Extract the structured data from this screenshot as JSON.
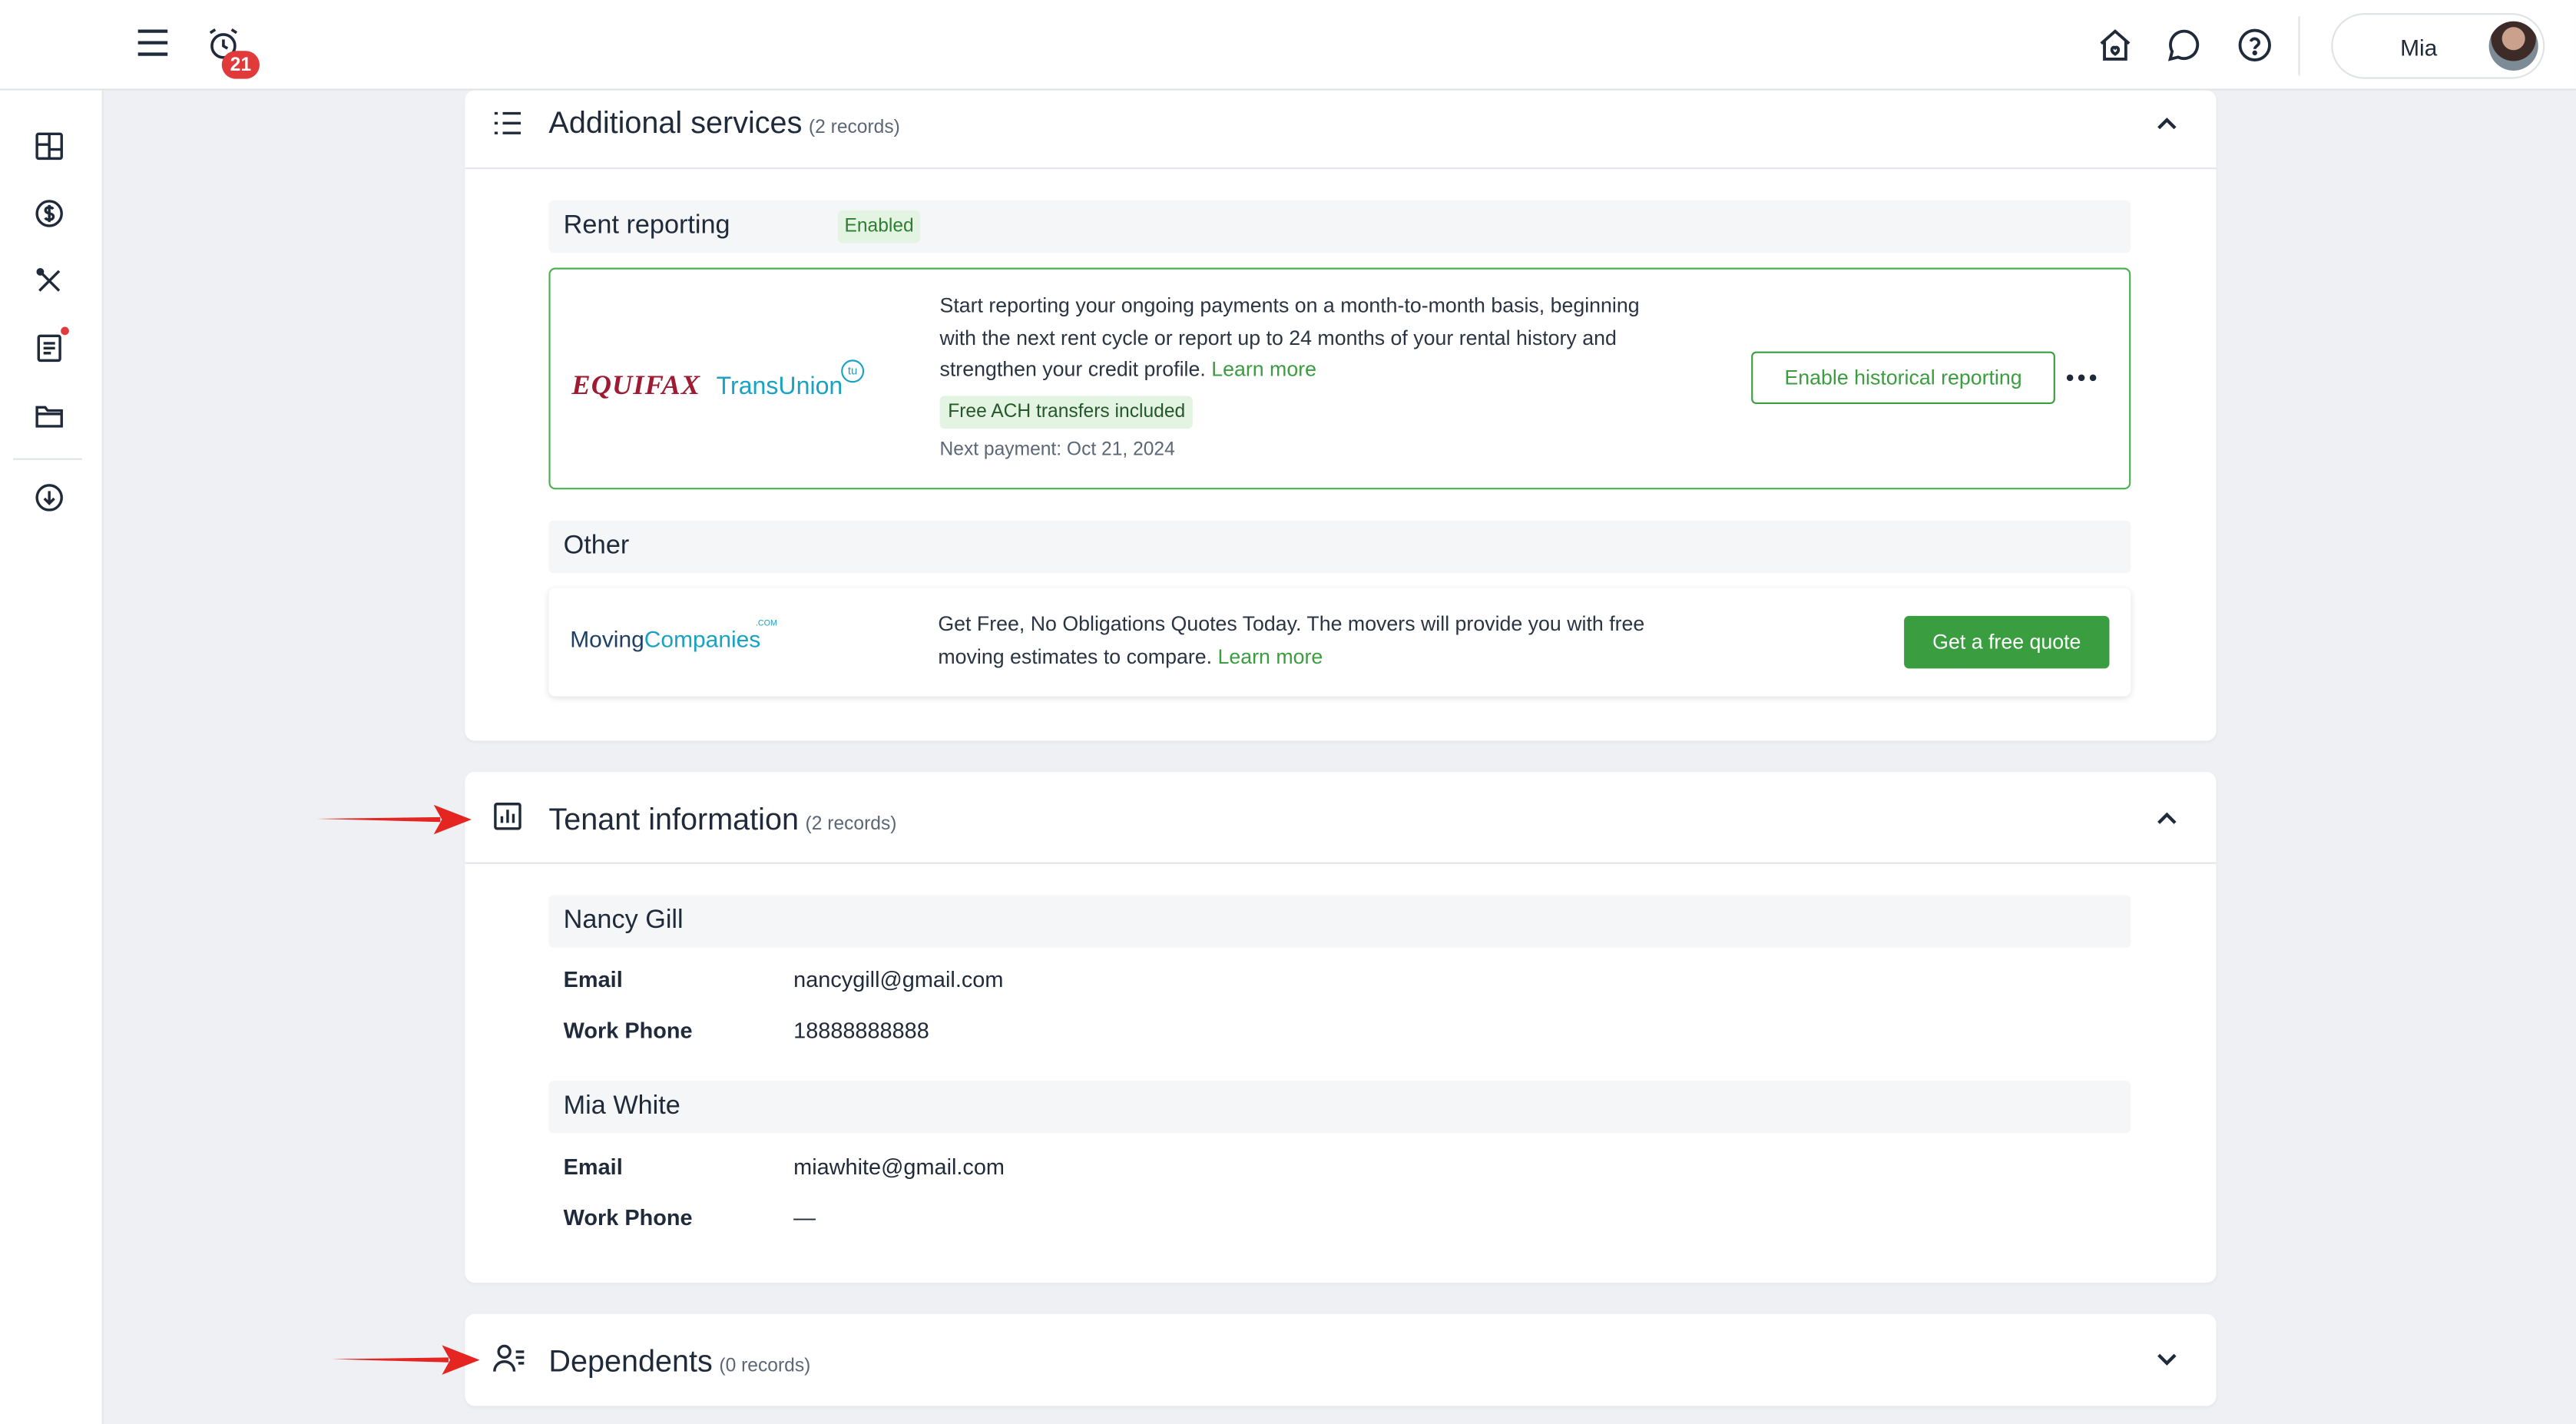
{
  "colors": {
    "accent_green": "#3a9d3f",
    "badge_red": "#e03a3a",
    "annotation_red": "#e52521",
    "equifax_red": "#9e1b32",
    "transunion_cyan": "#1aa2c4"
  },
  "topbar": {
    "menu_icon": "hamburger-icon",
    "alarm_icon": "alarm-clock-icon",
    "notification_count": "21",
    "home_icon": "home-icon",
    "chat_icon": "chat-bubble-icon",
    "help_icon": "help-circle-icon",
    "user_name": "Mia"
  },
  "sidebar": {
    "items": [
      {
        "icon": "dashboard-grid-icon"
      },
      {
        "icon": "dollar-circle-icon"
      },
      {
        "icon": "tools-icon"
      },
      {
        "icon": "document-list-icon",
        "has_notification_dot": true
      },
      {
        "icon": "folder-icon"
      },
      {
        "icon": "cloud-download-icon"
      }
    ]
  },
  "additional_services": {
    "title": "Additional services",
    "count": "(2 records)",
    "rent_reporting": {
      "label": "Rent reporting",
      "status": "Enabled",
      "logo_equifax": "EQUIFAX",
      "logo_transunion": "TransUnion",
      "logo_transunion_badge": "tu",
      "description_line1": "Start reporting your ongoing payments on a month-to-month basis, beginning",
      "description_line2": "with the next rent cycle or report up to 24 months of your rental history and",
      "description_line3": "strengthen your credit profile.",
      "learn_more": "Learn more",
      "free_tag": "Free ACH transfers included",
      "next_payment": "Next payment: Oct 21, 2024",
      "button_label": "Enable historical reporting"
    },
    "other": {
      "label": "Other",
      "logo_part1": "Moving",
      "logo_part2": "Companies",
      "logo_dotcom": ".COM",
      "description_line1": "Get Free, No Obligations Quotes Today. The movers will provide you with free",
      "description_line2": "moving estimates to compare.",
      "learn_more": "Learn more",
      "button_label": "Get a free quote"
    }
  },
  "tenant_information": {
    "title": "Tenant information",
    "count": "(2 records)",
    "tenants": [
      {
        "name": "Nancy Gill",
        "email_label": "Email",
        "email": "nancygill@gmail.com",
        "phone_label": "Work Phone",
        "phone": "18888888888"
      },
      {
        "name": "Mia White",
        "email_label": "Email",
        "email": "miawhite@gmail.com",
        "phone_label": "Work Phone",
        "phone": "—"
      }
    ]
  },
  "dependents": {
    "title": "Dependents",
    "count": "(0 records)"
  }
}
